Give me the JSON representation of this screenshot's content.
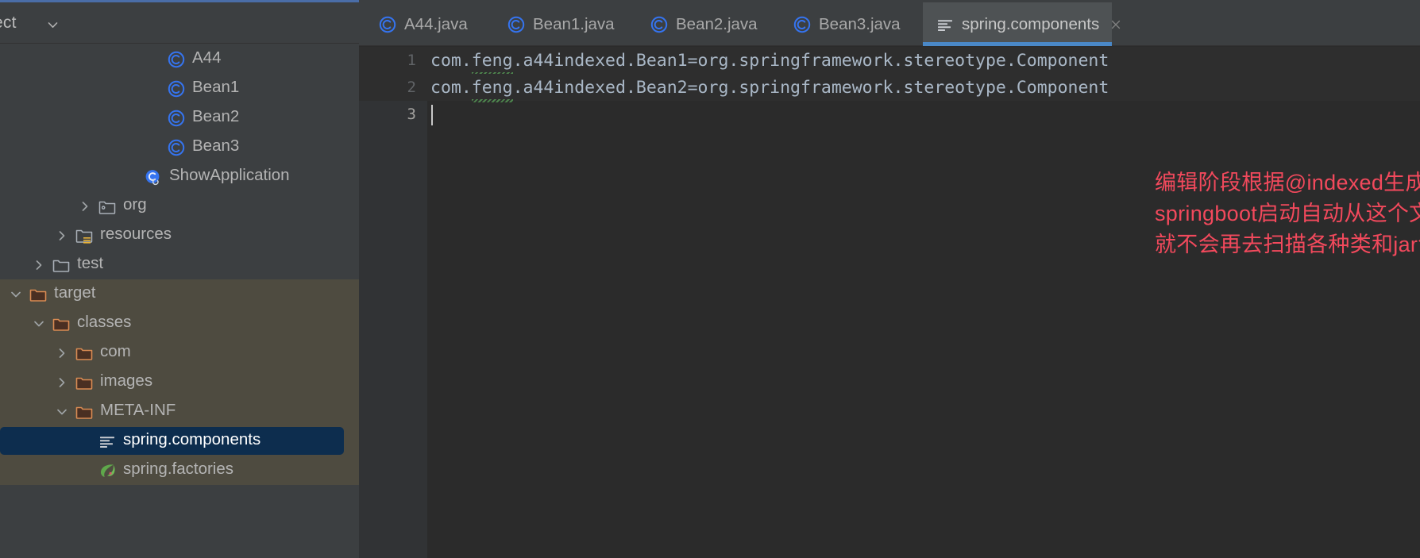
{
  "window": {
    "accent_color": "#4a6da7",
    "panel_bg": "#3c3f41",
    "editor_bg": "#2b2b2b",
    "selection_bg": "#0d2d4e",
    "excluded_bg": "#4e4b40",
    "active_tab_underline": "#4a88c7",
    "annotation_color": "#f2495c"
  },
  "project_panel": {
    "title": "ect",
    "collapse_icon": "chevron-down-icon",
    "tree": [
      {
        "label": "A44",
        "icon": "java-class-icon",
        "indent": 6,
        "arrow": "none",
        "excluded": false,
        "selected": false
      },
      {
        "label": "Bean1",
        "icon": "java-class-icon",
        "indent": 6,
        "arrow": "none",
        "excluded": false,
        "selected": false
      },
      {
        "label": "Bean2",
        "icon": "java-class-icon",
        "indent": 6,
        "arrow": "none",
        "excluded": false,
        "selected": false
      },
      {
        "label": "Bean3",
        "icon": "java-class-icon",
        "indent": 6,
        "arrow": "none",
        "excluded": false,
        "selected": false
      },
      {
        "label": "ShowApplication",
        "icon": "spring-boot-class-icon",
        "indent": 5,
        "arrow": "none",
        "excluded": false,
        "selected": false
      },
      {
        "label": "org",
        "icon": "package-folder-icon",
        "indent": 3,
        "arrow": "collapsed",
        "excluded": false,
        "selected": false
      },
      {
        "label": "resources",
        "icon": "resources-folder-icon",
        "indent": 2,
        "arrow": "collapsed",
        "excluded": false,
        "selected": false
      },
      {
        "label": "test",
        "icon": "folder-icon",
        "indent": 1,
        "arrow": "collapsed",
        "excluded": false,
        "selected": false
      },
      {
        "label": "target",
        "icon": "excluded-folder-icon",
        "indent": 0,
        "arrow": "expanded",
        "excluded": true,
        "selected": false
      },
      {
        "label": "classes",
        "icon": "excluded-folder-icon",
        "indent": 1,
        "arrow": "expanded",
        "excluded": true,
        "selected": false
      },
      {
        "label": "com",
        "icon": "excluded-folder-icon",
        "indent": 2,
        "arrow": "collapsed",
        "excluded": true,
        "selected": false
      },
      {
        "label": "images",
        "icon": "excluded-folder-icon",
        "indent": 2,
        "arrow": "collapsed",
        "excluded": true,
        "selected": false
      },
      {
        "label": "META-INF",
        "icon": "excluded-folder-icon",
        "indent": 2,
        "arrow": "expanded",
        "excluded": true,
        "selected": false
      },
      {
        "label": "spring.components",
        "icon": "properties-file-icon",
        "indent": 3,
        "arrow": "none",
        "excluded": true,
        "selected": true
      },
      {
        "label": "spring.factories",
        "icon": "spring-leaf-icon",
        "indent": 3,
        "arrow": "none",
        "excluded": true,
        "selected": false
      }
    ]
  },
  "editor": {
    "tabs": [
      {
        "label": "A44.java",
        "icon": "java-class-icon",
        "active": false,
        "closable": false
      },
      {
        "label": "Bean1.java",
        "icon": "java-class-icon",
        "active": false,
        "closable": false
      },
      {
        "label": "Bean2.java",
        "icon": "java-class-icon",
        "active": false,
        "closable": false
      },
      {
        "label": "Bean3.java",
        "icon": "java-class-icon",
        "active": false,
        "closable": false
      },
      {
        "label": "spring.components",
        "icon": "properties-file-icon",
        "active": true,
        "closable": true
      }
    ],
    "close_icon": "close-icon",
    "lines": [
      {
        "number": "1",
        "text": "com.feng.a44indexed.Bean1=org.springframework.stereotype.Component",
        "spell_error": "feng",
        "modified": true,
        "current": false
      },
      {
        "number": "2",
        "text": "com.feng.a44indexed.Bean2=org.springframework.stereotype.Component",
        "spell_error": "feng",
        "modified": true,
        "current": false
      },
      {
        "number": "3",
        "text": "",
        "spell_error": "",
        "modified": false,
        "current": true
      }
    ],
    "annotation": [
      "编辑阶段根据@indexed生成类定义，",
      "springboot启动自动从这个文件读取，",
      "就不会再去扫描各种类和jar包"
    ]
  }
}
